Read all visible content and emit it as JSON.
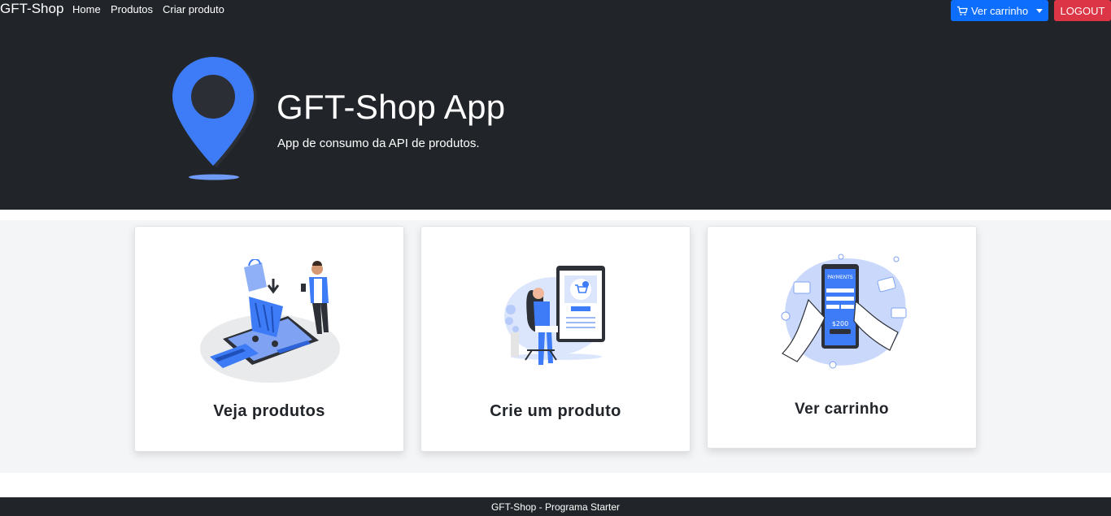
{
  "nav": {
    "brand": "GFT-Shop",
    "links": [
      "Home",
      "Produtos",
      "Criar produto"
    ],
    "cart_button": "Ver carrinho",
    "logout_button": "LOGOUT"
  },
  "hero": {
    "title": "GFT-Shop App",
    "subtitle": "App de consumo da API de produtos."
  },
  "cards": [
    {
      "title": "Veja produtos",
      "icon": "shopping-cart-illustration"
    },
    {
      "title": "Crie um produto",
      "icon": "create-product-illustration"
    },
    {
      "title": "Ver carrinho",
      "icon": "payment-illustration"
    }
  ],
  "footer": {
    "text": "GFT-Shop - Programa Starter"
  },
  "colors": {
    "dark": "#212529",
    "primary": "#0d6efd",
    "danger": "#dc3545",
    "accent_blue": "#3d7bf7",
    "section_bg": "#f4f5f7"
  }
}
